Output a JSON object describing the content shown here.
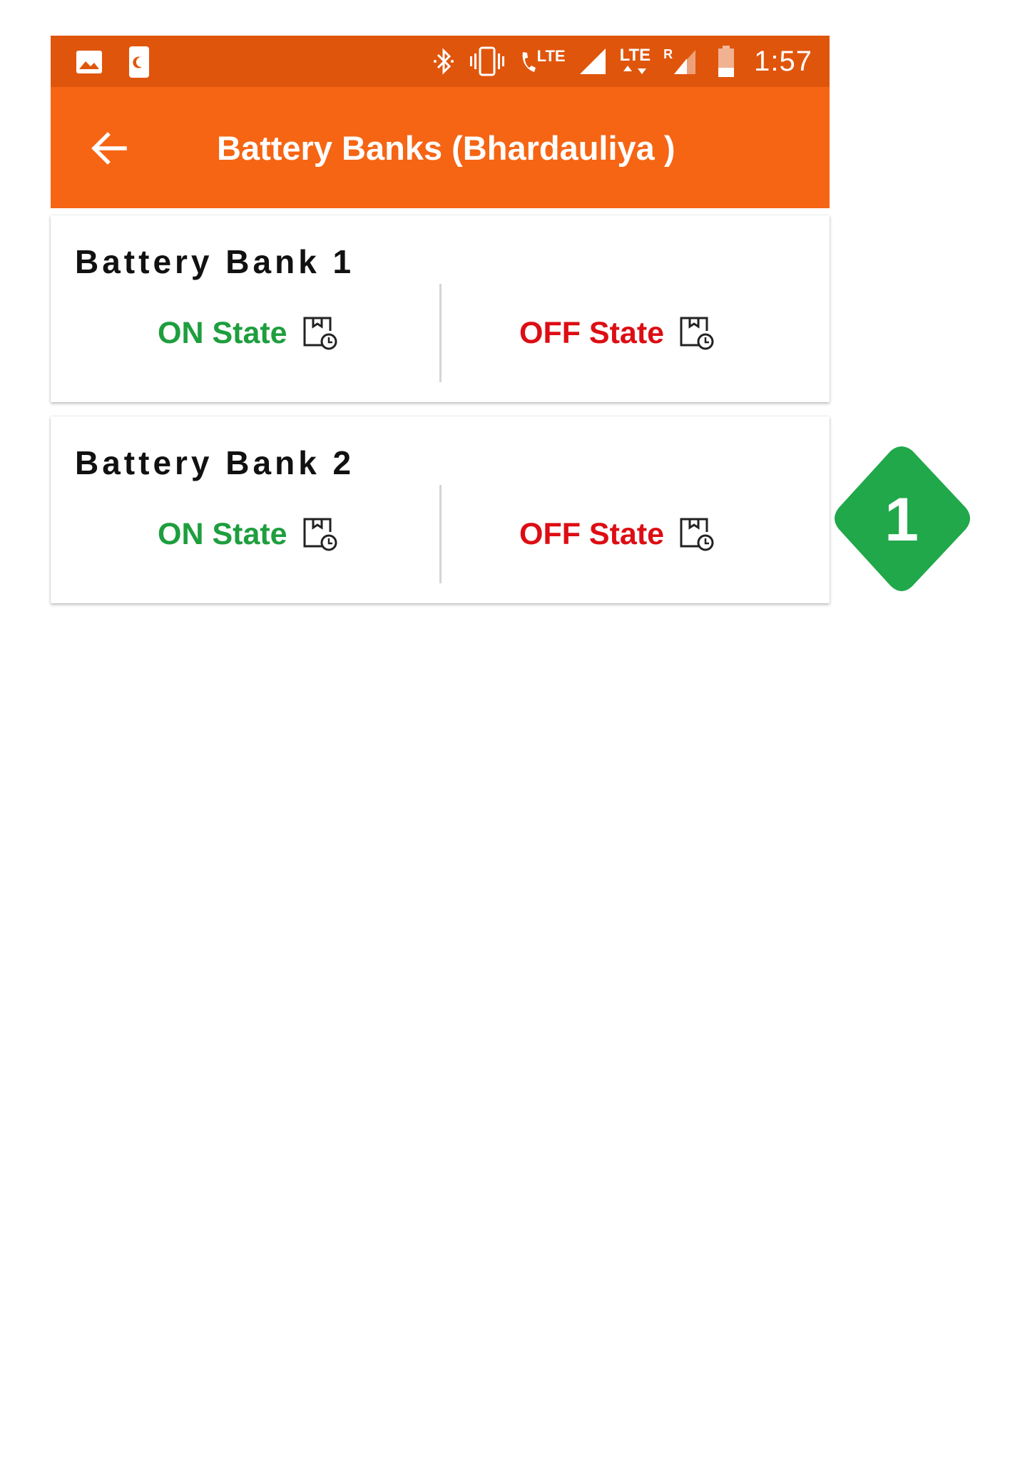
{
  "status_bar": {
    "time": "1:57",
    "lte_label": "LTE",
    "lte2_label": "LTE",
    "roaming_label": "R",
    "icons": [
      "image-icon",
      "moon-card-icon",
      "bluetooth-icon",
      "vibrate-icon",
      "volte-call-icon",
      "signal-icon",
      "lte-data-icon",
      "roaming-signal-icon",
      "battery-icon"
    ]
  },
  "app_bar": {
    "title": "Battery Banks (Bhardauliya )",
    "back_icon": "arrow-left-icon"
  },
  "banks": [
    {
      "name": "Battery Bank 1",
      "on_label": "ON State",
      "off_label": "OFF State"
    },
    {
      "name": "Battery Bank 2",
      "on_label": "ON State",
      "off_label": "OFF State"
    }
  ],
  "badge": {
    "number": "1",
    "color": "#20a84a"
  },
  "colors": {
    "status_bar": "#e0550c",
    "app_bar": "#f66514",
    "on_state": "#1e9e3e",
    "off_state": "#dd0d14"
  }
}
